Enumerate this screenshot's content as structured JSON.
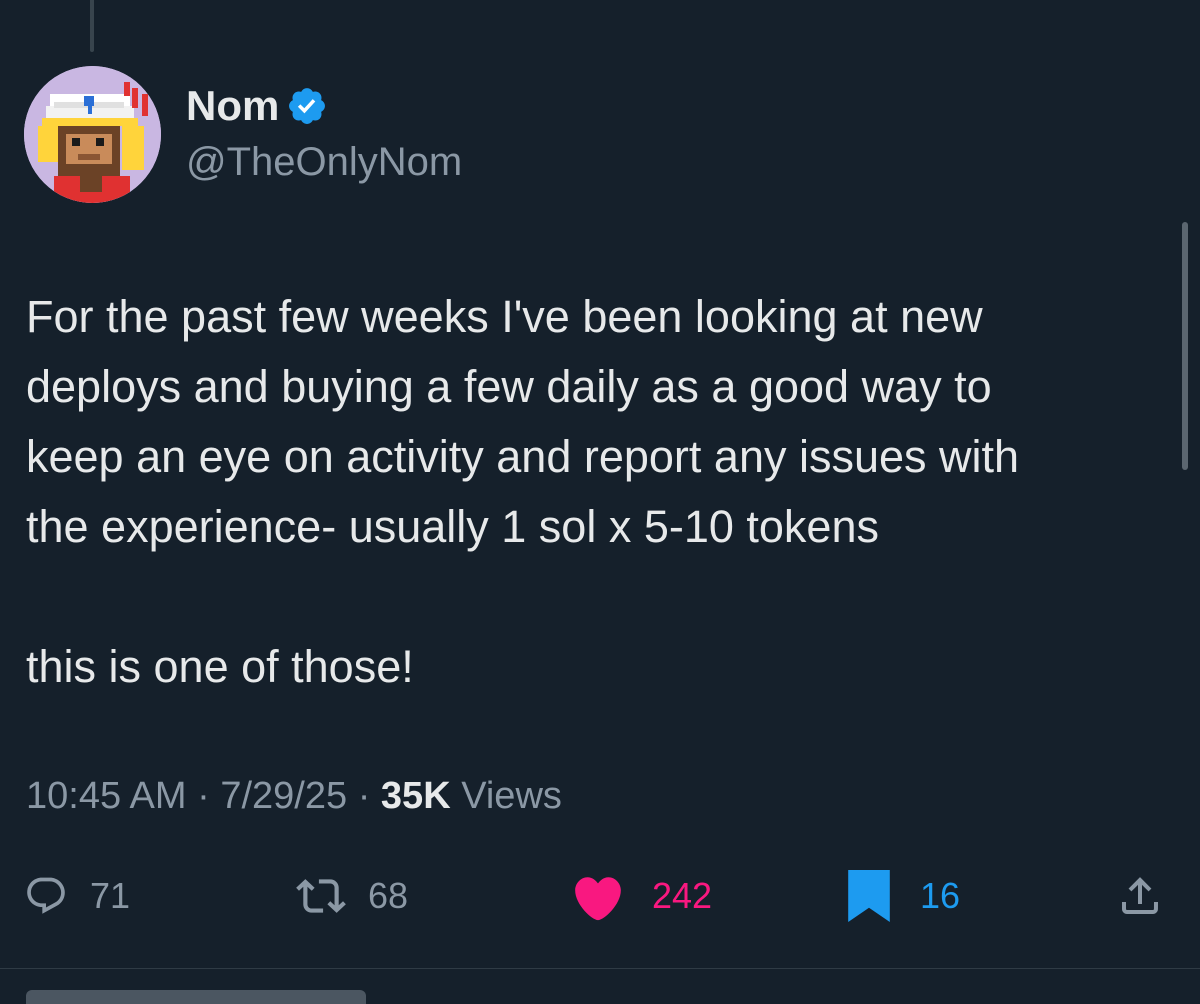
{
  "author": {
    "display_name": "Nom",
    "handle": "@TheOnlyNom",
    "verified": true,
    "avatar_icon": "pixel-monkey-captain-avatar"
  },
  "tweet": {
    "text": "For the past few weeks I've been looking at new\ndeploys and buying a few daily as a good way to\nkeep an eye on activity and report any issues with\nthe experience- usually 1 sol x 5-10 tokens\n\nthis is one of those!",
    "time": "10:45 AM",
    "separator": "·",
    "date": "7/29/25",
    "views_count": "35K",
    "views_label": "Views"
  },
  "actions": {
    "reply": {
      "icon": "reply-icon",
      "count": "71"
    },
    "retweet": {
      "icon": "retweet-icon",
      "count": "68"
    },
    "like": {
      "icon": "heart-icon",
      "count": "242",
      "color": "#f91880"
    },
    "bookmark": {
      "icon": "bookmark-icon",
      "count": "16",
      "color": "#1d9bf0"
    },
    "share": {
      "icon": "share-icon"
    }
  },
  "colors": {
    "background": "#15202b",
    "text": "#e7e9ea",
    "muted": "#8b98a5",
    "verified_badge": "#1d9bf0"
  }
}
